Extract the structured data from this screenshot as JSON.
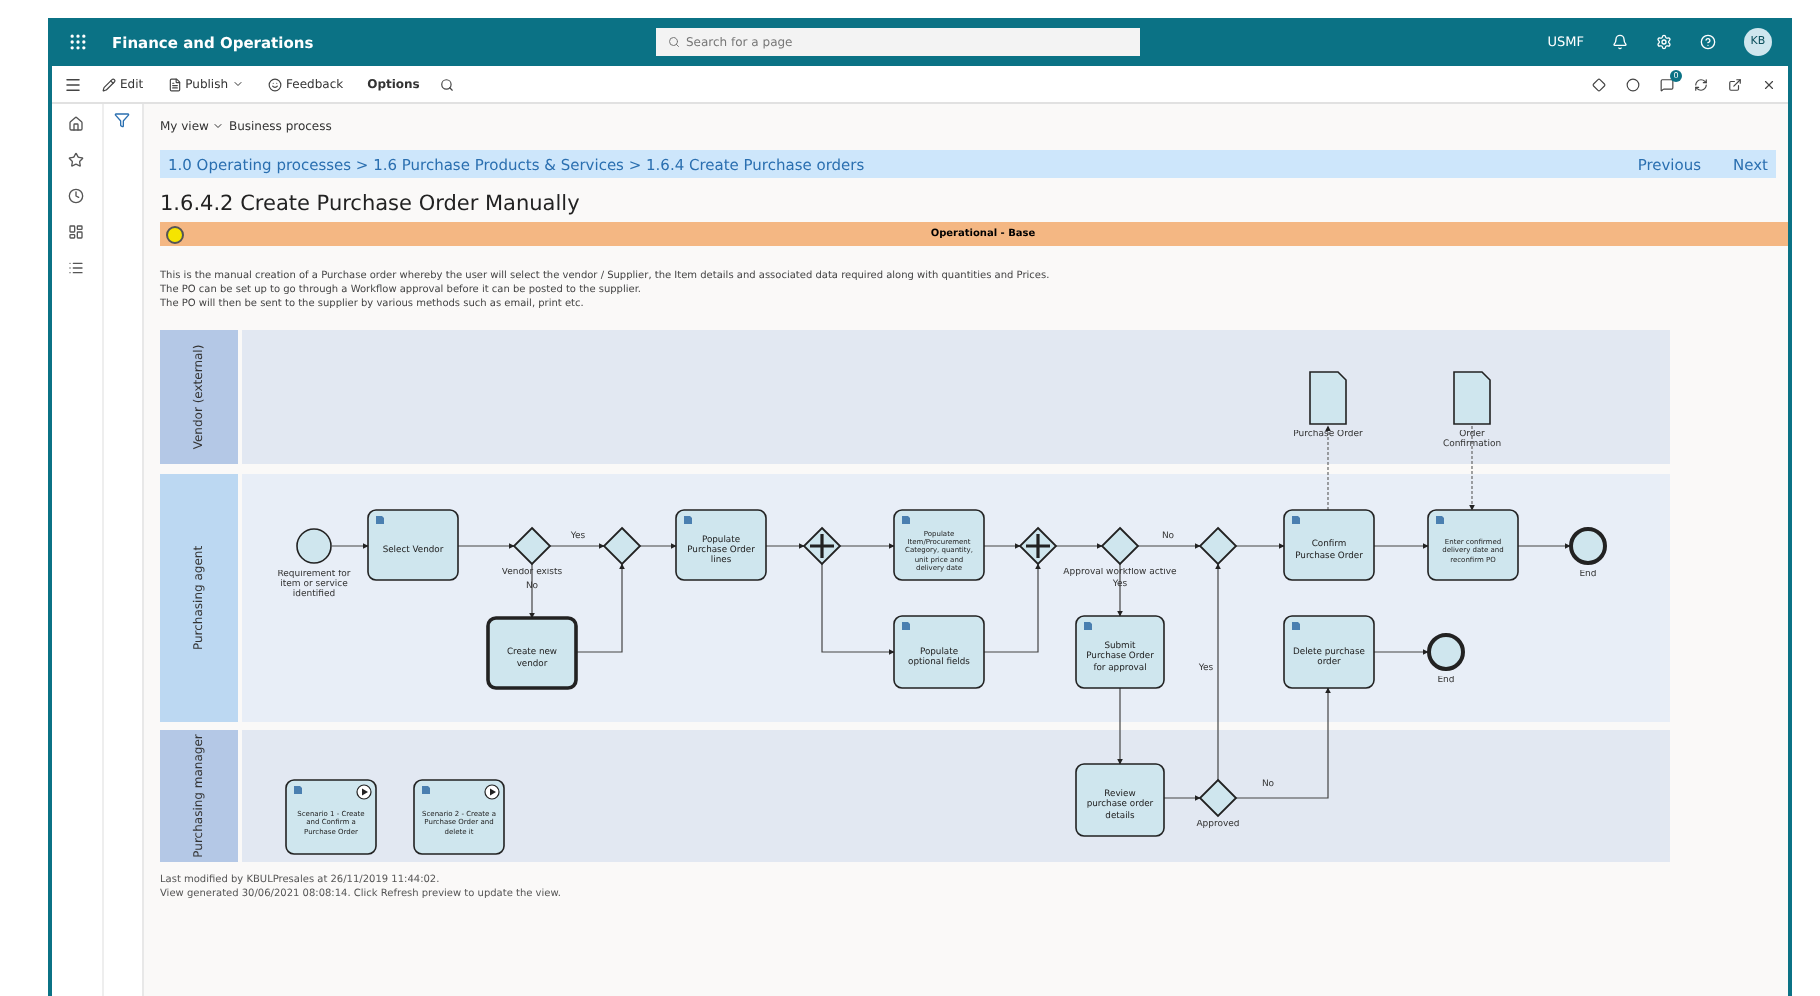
{
  "app_bar": {
    "title": "Finance and Operations",
    "search": {
      "placeholder": "Search for a page"
    },
    "company": "USMF",
    "avatar": "KB"
  },
  "command_bar": {
    "items": [
      "Edit",
      "Publish",
      "Feedback",
      "Options"
    ],
    "badge": "0"
  },
  "view": {
    "my_view": "My view",
    "name": "Business process"
  },
  "breadcrumb": {
    "path": "1.0 Operating processes > 1.6 Purchase Products & Services > 1.6.4 Create Purchase orders",
    "previous": "Previous",
    "next": "Next"
  },
  "title": "1.6.4.2 Create Purchase Order Manually",
  "status": {
    "label": "Operational - Base",
    "color": "#f5e400"
  },
  "description": [
    "This is the manual creation of a Purchase order whereby the user will select the vendor / Supplier, the Item details and associated data required along with quantities and Prices.",
    "The PO can be set up to go through a Workflow approval before it can be posted to the supplier.",
    "The PO will then be sent to the supplier by various methods such as email, print etc."
  ],
  "diagram": {
    "lanes": [
      "Vendor (external)",
      "Purchasing agent",
      "Purchasing manager"
    ],
    "nodes": [
      {
        "kind": "start",
        "label": "Requirement for item or service identified"
      },
      {
        "kind": "task",
        "label": "Select Vendor"
      },
      {
        "kind": "gateway",
        "label": "Vendor exists"
      },
      {
        "kind": "call_activity",
        "label": "Create new vendor"
      },
      {
        "kind": "gateway"
      },
      {
        "kind": "task",
        "label": "Populate Purchase Order lines"
      },
      {
        "kind": "parallel"
      },
      {
        "kind": "task",
        "label": "Populate Item/Procurement Category, quantity, unit price and delivery date"
      },
      {
        "kind": "task",
        "label": "Populate optional fields"
      },
      {
        "kind": "parallel"
      },
      {
        "kind": "gateway",
        "label": "Approval workflow active"
      },
      {
        "kind": "gateway"
      },
      {
        "kind": "task",
        "label": "Submit Purchase Order for approval"
      },
      {
        "kind": "task",
        "label": "Confirm Purchase Order"
      },
      {
        "kind": "task",
        "label": "Enter confirmed delivery date and reconfirm PO"
      },
      {
        "kind": "end",
        "label": "End"
      },
      {
        "kind": "task",
        "label": "Delete purchase order"
      },
      {
        "kind": "end",
        "label": "End"
      },
      {
        "kind": "document",
        "label": "Purchase Order"
      },
      {
        "kind": "document",
        "label": "Order Confirmation"
      },
      {
        "kind": "scenario",
        "label": "Scenario 1 - Create and Confirm a Purchase Order"
      },
      {
        "kind": "scenario",
        "label": "Scenario 2 - Create a Purchase Order and delete it"
      },
      {
        "kind": "plain_task",
        "label": "Review purchase order details"
      },
      {
        "kind": "gateway",
        "label": "Approved"
      }
    ],
    "edge_labels": [
      "Yes",
      "No",
      "No",
      "Yes",
      "Yes",
      "No"
    ]
  },
  "footer": [
    "Last modified by KBULPresales at 26/11/2019 11:44:02.",
    "View generated 30/06/2021 08:08:14. Click Refresh preview to update the view."
  ]
}
